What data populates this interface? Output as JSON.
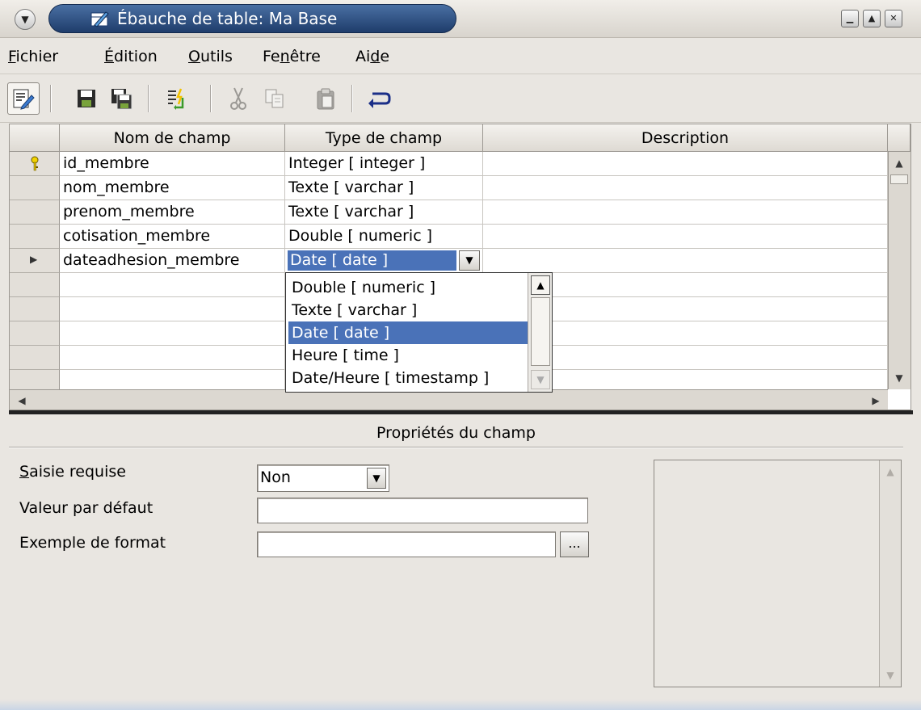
{
  "window": {
    "title": "Ébauche de table: Ma Base",
    "controls": [
      "minimize",
      "maximize",
      "close"
    ]
  },
  "menu": [
    {
      "label": "Fichier",
      "key_index": 0
    },
    {
      "label": "Édition",
      "key_index": 0
    },
    {
      "label": "Outils",
      "key_index": 0
    },
    {
      "label": "Fenêtre",
      "key_index": 2
    },
    {
      "label": "Aide",
      "key_index": 2
    }
  ],
  "toolbar": [
    {
      "name": "edit-mode-icon",
      "active": true
    },
    {
      "name": "save-icon"
    },
    {
      "name": "save-as-icon"
    },
    {
      "name": "index-design-icon"
    },
    {
      "name": "cut-icon",
      "disabled": true
    },
    {
      "name": "copy-icon",
      "disabled": true
    },
    {
      "name": "paste-icon",
      "disabled": true
    },
    {
      "name": "undo-icon"
    }
  ],
  "grid": {
    "columns": [
      "Nom de champ",
      "Type de champ",
      "Description"
    ],
    "rows": [
      {
        "marker": "key",
        "name": "id_membre",
        "type": "Integer [ integer ]",
        "description": ""
      },
      {
        "marker": "",
        "name": "nom_membre",
        "type": "Texte [ varchar ]",
        "description": ""
      },
      {
        "marker": "",
        "name": "prenom_membre",
        "type": "Texte [ varchar ]",
        "description": ""
      },
      {
        "marker": "",
        "name": "cotisation_membre",
        "type": "Double [ numeric ]",
        "description": ""
      },
      {
        "marker": "current",
        "name": "dateadhesion_membre",
        "type": "Date [ date ]",
        "description": ""
      },
      {
        "marker": "",
        "name": "",
        "type": "",
        "description": ""
      },
      {
        "marker": "",
        "name": "",
        "type": "",
        "description": ""
      },
      {
        "marker": "",
        "name": "",
        "type": "",
        "description": ""
      },
      {
        "marker": "",
        "name": "",
        "type": "",
        "description": ""
      },
      {
        "marker": "",
        "name": "",
        "type": "",
        "description": ""
      }
    ]
  },
  "type_dropdown": {
    "options": [
      "Double [ numeric ]",
      "Texte [ varchar ]",
      "Date [ date ]",
      "Heure [ time ]",
      "Date/Heure [ timestamp ]"
    ],
    "selected": "Date [ date ]"
  },
  "properties": {
    "title": "Propriétés du champ",
    "required_label": "Saisie requise",
    "required_value": "Non",
    "default_label": "Valeur par défaut",
    "default_value": "",
    "format_label": "Exemple de format",
    "format_value": "",
    "format_button": "...",
    "help_text": ""
  },
  "colors": {
    "selection": "#4a72b8",
    "title_bar": "#2a4a7d"
  }
}
